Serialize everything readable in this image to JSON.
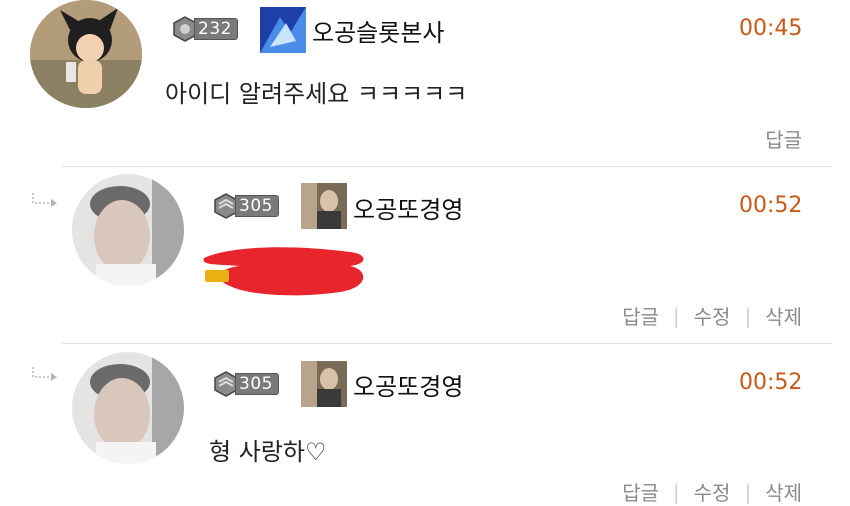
{
  "comments": [
    {
      "level": "232",
      "nickname": "오공슬롯본사",
      "time": "00:45",
      "text": "아이디 알려주세요 ㅋㅋㅋㅋㅋ",
      "actions": [
        "답글"
      ]
    },
    {
      "level": "305",
      "nickname": "오공또경영",
      "time": "00:52",
      "text": "",
      "actions": [
        "답글",
        "수정",
        "삭제"
      ]
    },
    {
      "level": "305",
      "nickname": "오공또경영",
      "time": "00:52",
      "text": "형 사랑하♡",
      "actions": [
        "답글",
        "수정",
        "삭제"
      ]
    }
  ],
  "colors": {
    "time": "#c85a18",
    "redaction": "#e8242c"
  }
}
